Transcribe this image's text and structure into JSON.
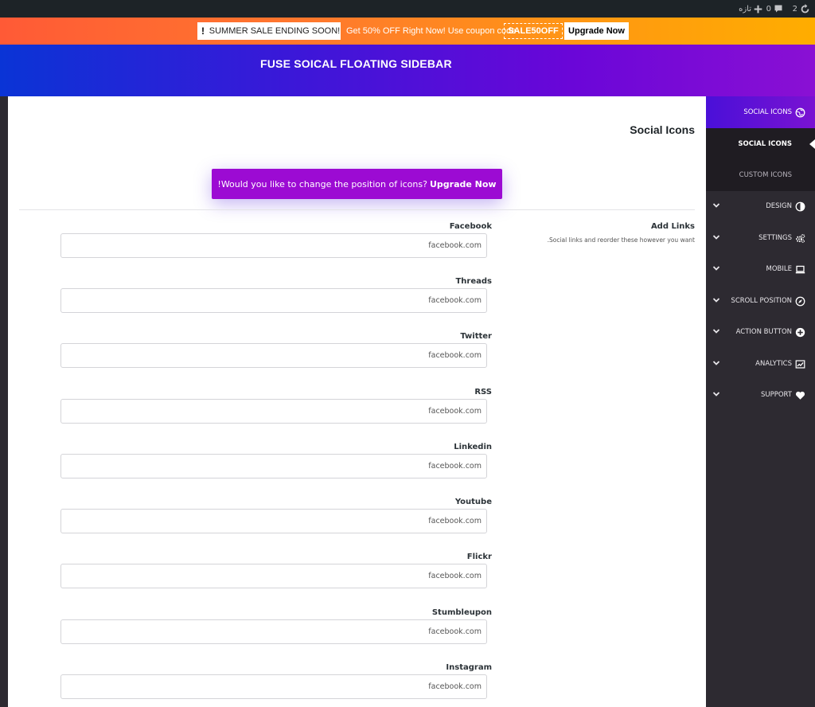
{
  "admin_bar": {
    "updates_count": "2",
    "comments_count": "0",
    "new_label": "تازه"
  },
  "promo": {
    "exclamation": "!",
    "sale_text": "SUMMER SALE ENDING SOON!",
    "offer_text": "Get 50% OFF Right Now! Use coupon code",
    "coupon": "SALE50OFF",
    "upgrade_label": "Upgrade Now"
  },
  "header": {
    "title": "FUSE SOICAL FLOATING SIDEBAR"
  },
  "panel": {
    "title": "Social Icons",
    "banner_text": "!Would you like to change the position of icons?",
    "banner_link": "Upgrade Now",
    "add_links_title": "Add Links",
    "add_links_desc": ".Social links and reorder these however you want"
  },
  "fields": [
    {
      "label": "Facebook",
      "placeholder": "facebook.com"
    },
    {
      "label": "Threads",
      "placeholder": "facebook.com"
    },
    {
      "label": "Twitter",
      "placeholder": "facebook.com"
    },
    {
      "label": "RSS",
      "placeholder": "facebook.com"
    },
    {
      "label": "Linkedin",
      "placeholder": "facebook.com"
    },
    {
      "label": "Youtube",
      "placeholder": "facebook.com"
    },
    {
      "label": "Flickr",
      "placeholder": "facebook.com"
    },
    {
      "label": "Stumbleupon",
      "placeholder": "facebook.com"
    },
    {
      "label": "Instagram",
      "placeholder": "facebook.com"
    }
  ],
  "sidebar": {
    "top": {
      "label": "SOCIAL ICONS",
      "icon": "social-globe-icon"
    },
    "sub_active": {
      "label": "SOCIAL ICONS"
    },
    "sub_other": {
      "label": "CUSTOM ICONS"
    },
    "items": [
      {
        "label": "DESIGN",
        "icon": "contrast-icon"
      },
      {
        "label": "SETTINGS",
        "icon": "gears-icon"
      },
      {
        "label": "MOBILE",
        "icon": "laptop-icon"
      },
      {
        "label": "SCROLL POSITION",
        "icon": "compass-icon"
      },
      {
        "label": "ACTION BUTTON",
        "icon": "plus-circle-icon"
      },
      {
        "label": "ANALYTICS",
        "icon": "chart-icon"
      },
      {
        "label": "SUPPORT",
        "icon": "heart-icon"
      }
    ]
  },
  "colors": {
    "accent": "#9c0bd3",
    "header_start": "#0a34d6",
    "header_end": "#8a10d4",
    "promo_start": "#ff5a36",
    "promo_end": "#ffad00",
    "sidebar_bg": "#2d2a31"
  }
}
